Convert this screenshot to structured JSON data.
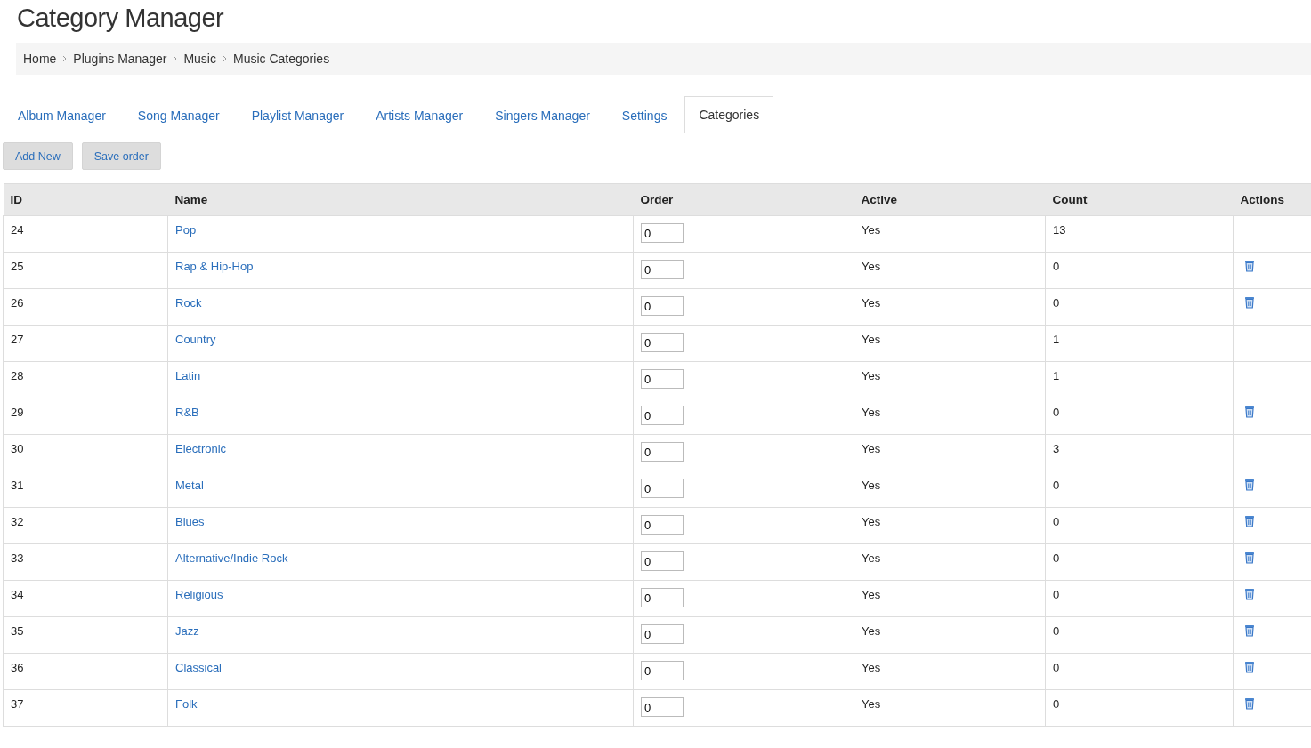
{
  "title": "Category Manager",
  "breadcrumb": [
    "Home",
    "Plugins Manager",
    "Music",
    "Music Categories"
  ],
  "tabs": [
    {
      "label": "Album Manager",
      "selected": false
    },
    {
      "label": "Song Manager",
      "selected": false
    },
    {
      "label": "Playlist Manager",
      "selected": false
    },
    {
      "label": "Artists Manager",
      "selected": false
    },
    {
      "label": "Singers Manager",
      "selected": false
    },
    {
      "label": "Settings",
      "selected": false
    },
    {
      "label": "Categories",
      "selected": true
    }
  ],
  "buttons": [
    "Add New",
    "Save order"
  ],
  "table": {
    "columns": [
      "ID",
      "Name",
      "Order",
      "Active",
      "Count",
      "Actions"
    ],
    "rows": [
      {
        "id": "24",
        "name": "Pop",
        "order": "0",
        "active": "Yes",
        "count": "13",
        "deletable": false
      },
      {
        "id": "25",
        "name": "Rap & Hip-Hop",
        "order": "0",
        "active": "Yes",
        "count": "0",
        "deletable": true
      },
      {
        "id": "26",
        "name": "Rock",
        "order": "0",
        "active": "Yes",
        "count": "0",
        "deletable": true
      },
      {
        "id": "27",
        "name": "Country",
        "order": "0",
        "active": "Yes",
        "count": "1",
        "deletable": false
      },
      {
        "id": "28",
        "name": "Latin",
        "order": "0",
        "active": "Yes",
        "count": "1",
        "deletable": false
      },
      {
        "id": "29",
        "name": "R&B",
        "order": "0",
        "active": "Yes",
        "count": "0",
        "deletable": true
      },
      {
        "id": "30",
        "name": "Electronic",
        "order": "0",
        "active": "Yes",
        "count": "3",
        "deletable": false
      },
      {
        "id": "31",
        "name": "Metal",
        "order": "0",
        "active": "Yes",
        "count": "0",
        "deletable": true
      },
      {
        "id": "32",
        "name": "Blues",
        "order": "0",
        "active": "Yes",
        "count": "0",
        "deletable": true
      },
      {
        "id": "33",
        "name": "Alternative/Indie Rock",
        "order": "0",
        "active": "Yes",
        "count": "0",
        "deletable": true
      },
      {
        "id": "34",
        "name": "Religious",
        "order": "0",
        "active": "Yes",
        "count": "0",
        "deletable": true
      },
      {
        "id": "35",
        "name": "Jazz",
        "order": "0",
        "active": "Yes",
        "count": "0",
        "deletable": true
      },
      {
        "id": "36",
        "name": "Classical",
        "order": "0",
        "active": "Yes",
        "count": "0",
        "deletable": true
      },
      {
        "id": "37",
        "name": "Folk",
        "order": "0",
        "active": "Yes",
        "count": "0",
        "deletable": true
      }
    ]
  }
}
